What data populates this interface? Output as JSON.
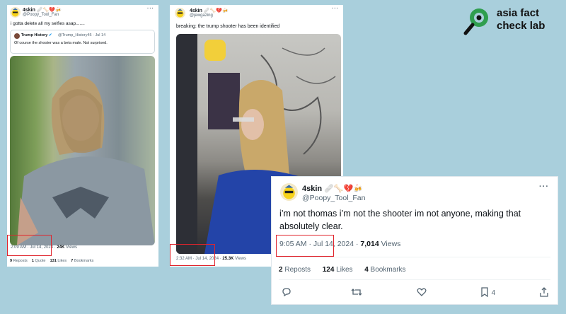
{
  "logo": {
    "line1": "asia fact",
    "line2": "check lab"
  },
  "tweet1": {
    "name": "4skin",
    "emoji": "🩹🦴💔🍻",
    "handle": "@Poopy_Tool_Fan",
    "text": "i gotta delete all my selfies asap.......",
    "quote": {
      "name": "Trump History",
      "verified": "✔",
      "handle": "@Trump_History45 · Jul 14",
      "text": "Of course the shooter was a beta male. Not surprised."
    },
    "time": "2:09 AM · Jul 14, 2024 ·",
    "views_count": "24K",
    "views_label": "Views",
    "reposts_count": "9",
    "reposts_label": "Reposts",
    "quotes_count": "1",
    "quotes_label": "Quote",
    "likes_count": "131",
    "likes_label": "Likes",
    "bookmarks_count": "7",
    "bookmarks_label": "Bookmarks"
  },
  "tweet2": {
    "name": "4skin",
    "emoji": "🩹🦴💔🍻",
    "handle": "@jewgazing",
    "text": "breaking: the trump shooter has been identified",
    "time": "2:32 AM · Jul 14, 2024 ·",
    "views_count": "25.3K",
    "views_label": "Views"
  },
  "tweet3": {
    "name": "4skin",
    "emoji": "🩹🦴💔🍻",
    "handle": "@Poopy_Tool_Fan",
    "text_line1": "i’m not thomas i’m not the shooter im not anyone, making that",
    "text_line2": "absolutely clear.",
    "time": "9:05 AM · Jul 14, 2024 ·",
    "views_count": "7,014",
    "views_label": "Views",
    "reposts_count": "2",
    "reposts_label": "Reposts",
    "likes_count": "124",
    "likes_label": "Likes",
    "bookmarks_count": "4",
    "bookmarks_label": "Bookmarks",
    "bookmark_action_count": "4"
  },
  "icons": {
    "more": "more-icon",
    "reply": "reply-icon",
    "retweet": "retweet-icon",
    "like": "like-icon",
    "bookmark": "bookmark-icon",
    "share": "share-icon"
  },
  "colors": {
    "background": "#a9cfdc",
    "highlight_box": "#e0242c",
    "secondary_text": "#536471",
    "logo_green": "#2f9e4f"
  }
}
